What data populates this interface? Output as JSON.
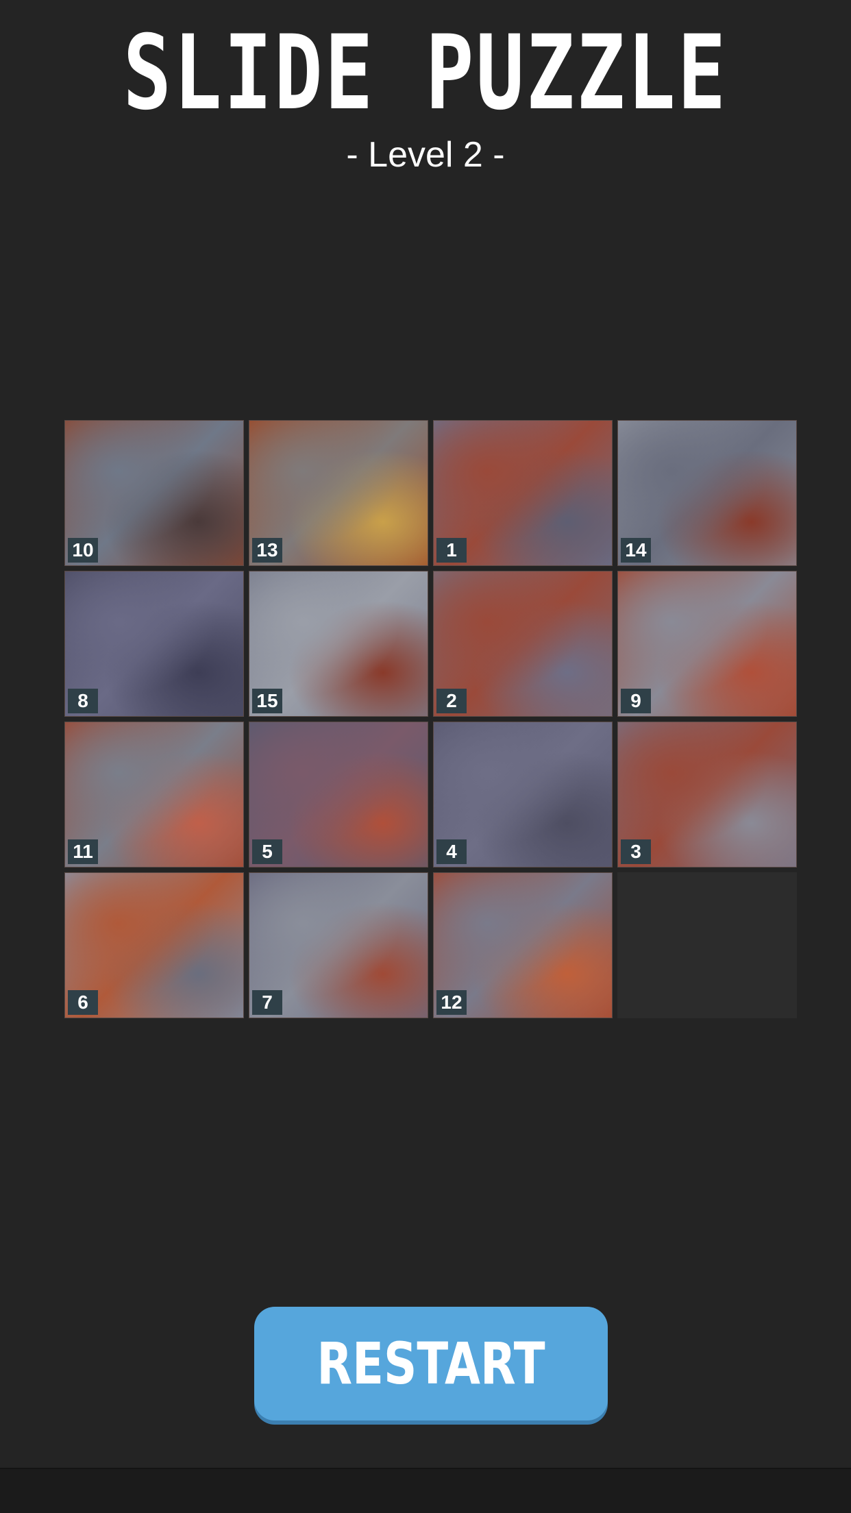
{
  "header": {
    "title": "SLIDE PUZZLE",
    "level_label": "- Level 2 -"
  },
  "board": {
    "rows": 4,
    "cols": 4,
    "tiles": [
      {
        "number": "10",
        "colors": [
          "#8a4a36",
          "#6f7888",
          "#4a3a3a"
        ]
      },
      {
        "number": "13",
        "colors": [
          "#9a4a2a",
          "#7f7a7a",
          "#c9a04a"
        ]
      },
      {
        "number": "1",
        "colors": [
          "#6e6e86",
          "#9a4a3a",
          "#5e5e72"
        ]
      },
      {
        "number": "14",
        "colors": [
          "#8a8e9a",
          "#6a6e7e",
          "#8a3a2a"
        ]
      },
      {
        "number": "8",
        "colors": [
          "#4e4e66",
          "#6a6a86",
          "#3e3e56"
        ]
      },
      {
        "number": "15",
        "colors": [
          "#7a7e8e",
          "#9a9ea8",
          "#8a3a2a"
        ]
      },
      {
        "number": "2",
        "colors": [
          "#7a6a76",
          "#9a4a3a",
          "#6e6e86"
        ]
      },
      {
        "number": "9",
        "colors": [
          "#a04a36",
          "#8a8a96",
          "#b0503a"
        ]
      },
      {
        "number": "11",
        "colors": [
          "#9a4a36",
          "#7a7e8a",
          "#c0604a"
        ]
      },
      {
        "number": "5",
        "colors": [
          "#5a5a70",
          "#7a5a6a",
          "#b0503a"
        ]
      },
      {
        "number": "4",
        "colors": [
          "#5a5a72",
          "#6e6e86",
          "#4e4e62"
        ]
      },
      {
        "number": "3",
        "colors": [
          "#7a6e7e",
          "#9a4a3a",
          "#8a8a96"
        ]
      },
      {
        "number": "6",
        "colors": [
          "#8a8e9e",
          "#b05a3a",
          "#6a6e7e"
        ]
      },
      {
        "number": "7",
        "colors": [
          "#6a6a80",
          "#8a8e9a",
          "#a04a36"
        ]
      },
      {
        "number": "12",
        "colors": [
          "#a04a36",
          "#7a7a8a",
          "#c0603a"
        ]
      },
      {
        "number": "",
        "empty": true
      }
    ]
  },
  "controls": {
    "restart_label": "RESTART"
  },
  "colors": {
    "background": "#242424",
    "button": "#56a6dc",
    "number_badge": "#2f4048",
    "empty_slot": "#2c2c2c"
  }
}
